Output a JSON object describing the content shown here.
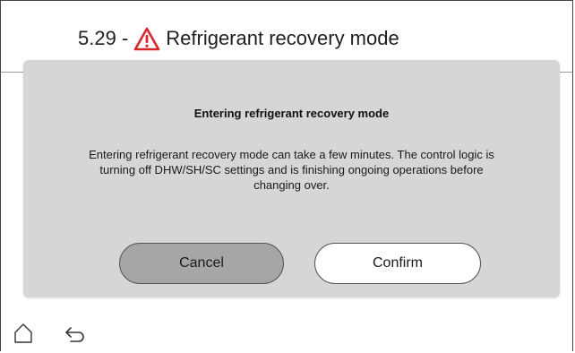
{
  "header": {
    "code": "5.29 -",
    "warning_icon": "warning-triangle-icon",
    "warning_color": "#d9262c",
    "title": "Refrigerant recovery mode"
  },
  "dialog": {
    "title": "Entering refrigerant recovery mode",
    "body_lines": [
      "Entering refrigerant recovery mode can take a few minutes. The control logic is",
      "turning off DHW/SH/SC settings and is finishing ongoing operations before",
      "changing over."
    ],
    "cancel_label": "Cancel",
    "confirm_label": "Confirm",
    "background_color": "#d6d6d6",
    "cancel_color": "#a6a6a6"
  },
  "footer": {
    "home_icon": "home-icon",
    "back_icon": "back-arrow-icon"
  }
}
